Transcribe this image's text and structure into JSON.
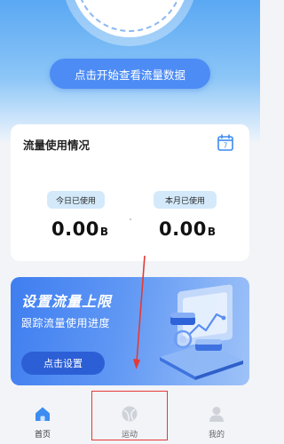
{
  "hero": {
    "start_button_label": "点击开始查看流量数据"
  },
  "usage_card": {
    "title": "流量使用情况",
    "calendar_day": "7",
    "today_label": "今日已使用",
    "today_value": "0.00",
    "today_unit": "B",
    "month_label": "本月已使用",
    "month_value": "0.00",
    "month_unit": "B"
  },
  "banner": {
    "title": "设置流量上限",
    "subtitle": "跟踪流量使用进度",
    "button_label": "点击设置"
  },
  "tabbar": {
    "items": [
      {
        "label": "首页",
        "icon": "home-icon",
        "active": true
      },
      {
        "label": "运动",
        "icon": "ball-icon",
        "active": false
      },
      {
        "label": "我的",
        "icon": "user-icon",
        "active": false
      }
    ]
  },
  "colors": {
    "accent": "#4d8cf5",
    "annotation": "#e53935"
  }
}
